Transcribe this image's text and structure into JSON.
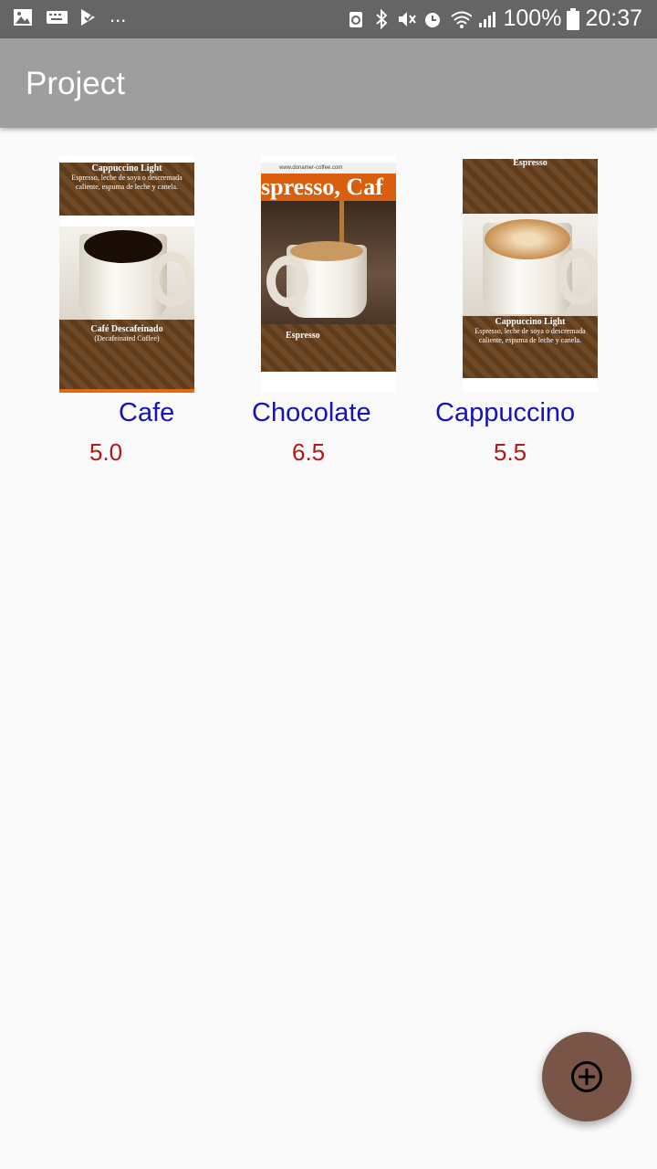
{
  "status_bar": {
    "left_icons": [
      "gallery-icon",
      "keyboard-icon",
      "task-icon",
      "more-notifications-icon"
    ],
    "more_text": "...",
    "right_icons": [
      "recycle-icon",
      "bluetooth-icon",
      "mute-icon",
      "alarm-icon",
      "wifi-icon",
      "signal-icon"
    ],
    "battery": "100%",
    "time": "20:37"
  },
  "app_bar": {
    "title": "Project"
  },
  "items": [
    {
      "name": "Cafe",
      "price": "5.0",
      "thumbnail": {
        "top_title": "Cappuccino Light",
        "top_desc": "Espresso, leche de soya o descremada caliente, espuma de leche y canela.",
        "bottom_title": "Café Descafeinado",
        "bottom_desc": "(Decafeinated Coffee)"
      }
    },
    {
      "name": "Chocolate",
      "price": "6.5",
      "thumbnail": {
        "url_text": "www.donamer-coffee.com",
        "banner": "spresso, Caf",
        "caption": "Espresso"
      }
    },
    {
      "name": "Cappuccino",
      "price": "5.5",
      "thumbnail": {
        "top_title": "Espresso",
        "bottom_title": "Cappuccino Light",
        "bottom_desc": "Espresso, leche de soya o descremada caliente, espuma de leche y canela."
      }
    }
  ],
  "fab": {
    "icon": "add-circle-icon"
  },
  "colors": {
    "status_bar": "#656565",
    "app_bar": "#9e9e9e",
    "name": "#1414b8",
    "price": "#b81616",
    "fab": "#795548"
  }
}
